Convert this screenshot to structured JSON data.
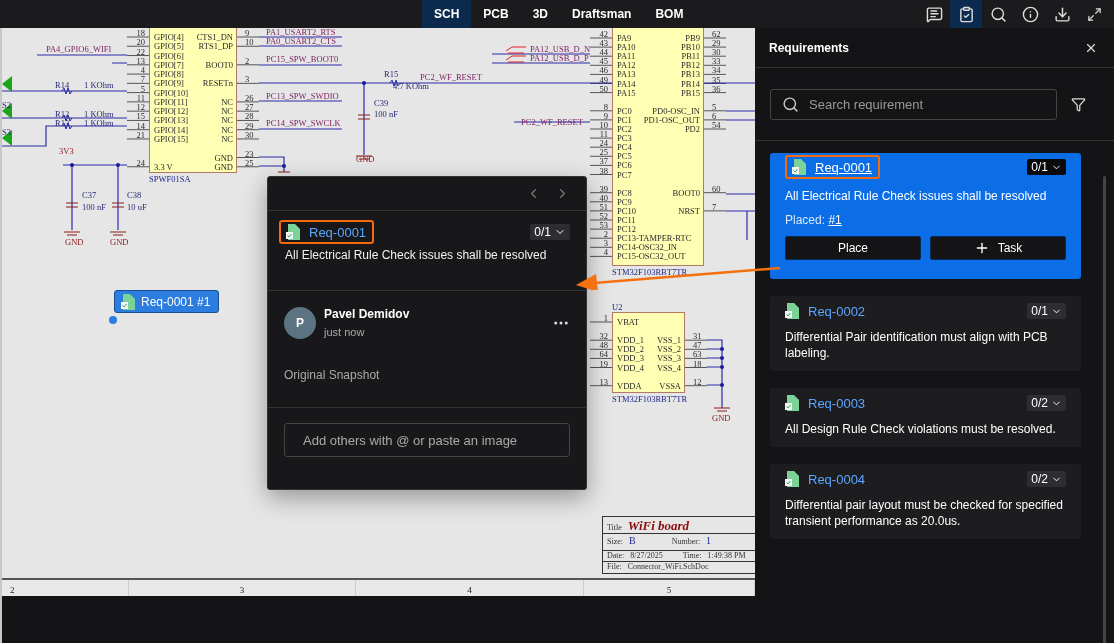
{
  "toolbar": {
    "tabs": [
      {
        "label": "SCH",
        "selected": true
      },
      {
        "label": "PCB",
        "selected": false
      },
      {
        "label": "3D",
        "selected": false
      },
      {
        "label": "Draftsman",
        "selected": false
      },
      {
        "label": "BOM",
        "selected": false
      }
    ],
    "requirements_button": {
      "selected": true
    }
  },
  "schematic": {
    "chips": [
      {
        "part": "SPWF01SA",
        "left_pins": [
          {
            "number": "18",
            "name": "GPIO[4]"
          },
          {
            "number": "20",
            "name": "GPIO[5]"
          },
          {
            "number": "22",
            "name": "GPIO[6]"
          },
          {
            "number": "13",
            "name": "GPIO[7]"
          },
          {
            "number": "4",
            "name": "GPIO[8]"
          },
          {
            "number": "7",
            "name": "GPIO[9]"
          },
          {
            "number": "5",
            "name": "GPIO[10]"
          },
          {
            "number": "11",
            "name": "GPIO[11]"
          },
          {
            "number": "12",
            "name": "GPIO[12]"
          },
          {
            "number": "15",
            "name": "GPIO[13]"
          },
          {
            "number": "14",
            "name": "GPIO[14]"
          },
          {
            "number": "21",
            "name": "GPIO[15]"
          },
          {
            "number": "24",
            "name": "3.3 V"
          }
        ],
        "right_pins": [
          {
            "number": "9",
            "name": "CTS1_DN"
          },
          {
            "number": "10",
            "name": "RTS1_DP"
          },
          {
            "number": "2",
            "name": "BOOT0"
          },
          {
            "number": "3",
            "name": "RESETn"
          },
          {
            "number": "26",
            "name": "NC"
          },
          {
            "number": "27",
            "name": "NC"
          },
          {
            "number": "28",
            "name": "NC"
          },
          {
            "number": "29",
            "name": "NC"
          },
          {
            "number": "30",
            "name": "NC"
          },
          {
            "number": "23",
            "name": "GND"
          },
          {
            "number": "25",
            "name": "GND"
          }
        ]
      },
      {
        "part": "STM32F103RBT7TR",
        "left_pins": [
          {
            "number": "42",
            "name": "PA9"
          },
          {
            "number": "43",
            "name": "PA10"
          },
          {
            "number": "44",
            "name": "PA11"
          },
          {
            "number": "45",
            "name": "PA12"
          },
          {
            "number": "46",
            "name": "PA13"
          },
          {
            "number": "49",
            "name": "PA14"
          },
          {
            "number": "50",
            "name": "PA15"
          },
          {
            "number": "8",
            "name": "PC0"
          },
          {
            "number": "9",
            "name": "PC1"
          },
          {
            "number": "10",
            "name": "PC2"
          },
          {
            "number": "11",
            "name": "PC3"
          },
          {
            "number": "24",
            "name": "PC4"
          },
          {
            "number": "25",
            "name": "PC5"
          },
          {
            "number": "37",
            "name": "PC6"
          },
          {
            "number": "38",
            "name": "PC7"
          },
          {
            "number": "39",
            "name": "PC8"
          },
          {
            "number": "40",
            "name": "PC9"
          },
          {
            "number": "51",
            "name": "PC10"
          },
          {
            "number": "52",
            "name": "PC11"
          },
          {
            "number": "53",
            "name": "PC12"
          },
          {
            "number": "2",
            "name": "PC13-TAMPER-RTC"
          },
          {
            "number": "3",
            "name": "PC14-OSC32_IN"
          },
          {
            "number": "4",
            "name": "PC15-OSC32_OUT"
          }
        ],
        "right_pins": [
          {
            "number": "62",
            "name": "PB9"
          },
          {
            "number": "29",
            "name": "PB10"
          },
          {
            "number": "30",
            "name": "PB11"
          },
          {
            "number": "33",
            "name": "PB12"
          },
          {
            "number": "34",
            "name": "PB13"
          },
          {
            "number": "35",
            "name": "PB14"
          },
          {
            "number": "36",
            "name": "PB15"
          },
          {
            "number": "5",
            "name": "PD0-OSC_IN"
          },
          {
            "number": "6",
            "name": "PD1-OSC_OUT"
          },
          {
            "number": "54",
            "name": "PD2"
          },
          {
            "number": "60",
            "name": "BOOT0"
          },
          {
            "number": "7",
            "name": "NRST"
          }
        ]
      },
      {
        "designator": "U2",
        "part": "STM32F103RBT7TR",
        "left_pins": [
          {
            "number": "1",
            "name": "VBAT"
          },
          {
            "number": "32",
            "name": "VDD_1"
          },
          {
            "number": "48",
            "name": "VDD_2"
          },
          {
            "number": "64",
            "name": "VDD_3"
          },
          {
            "number": "19",
            "name": "VDD_4"
          },
          {
            "number": "13",
            "name": "VDDA"
          }
        ],
        "right_pins": [
          {
            "number": "31",
            "name": "VSS_1"
          },
          {
            "number": "47",
            "name": "VSS_2"
          },
          {
            "number": "63",
            "name": "VSS_3"
          },
          {
            "number": "18",
            "name": "VSS_4"
          },
          {
            "number": "12",
            "name": "VSSA"
          }
        ]
      }
    ],
    "net_labels": [
      "PA4_GPIO6_WIFI",
      "PA1_USART2_RTS",
      "PA0_USART2_CTS",
      "PC15_SPW_BOOT0",
      "PC13_SPW_SWDIO",
      "PC14_SPW_SWCLK",
      "PC2_WF_RESET",
      "PA12_USB_D_N",
      "PA12_USB_D_P",
      "PC2_WF_RESET"
    ],
    "parts": [
      {
        "ref": "R14",
        "value": "1 KOhm"
      },
      {
        "ref": "R12",
        "value": "1 KOhm"
      },
      {
        "ref": "R13",
        "value": "1 KOhm"
      },
      {
        "ref": "R15",
        "value": "4.7 KOhm"
      },
      {
        "ref": "C37",
        "value": "100 nF"
      },
      {
        "ref": "C38",
        "value": "10 uF"
      },
      {
        "ref": "C39",
        "value": "100 nF"
      }
    ],
    "power_labels": [
      "3V3",
      "GND",
      "GND",
      "GND",
      "GND"
    ],
    "connector_labels": [
      "S2",
      "S3"
    ],
    "title_block": {
      "title_caption": "Title",
      "title": "WiFi board",
      "size_caption": "Size:",
      "size": "B",
      "number_caption": "Number:",
      "number": "1",
      "date_caption": "Date:",
      "date": "8/27/2025",
      "time_caption": "Time:",
      "time": "1:49:38 PM",
      "file_caption": "File:",
      "file": "Connector_WiFi.SchDoc"
    },
    "ruler": [
      "2",
      "3",
      "4",
      "5"
    ]
  },
  "placement_pin": {
    "label": "Req-0001 #1"
  },
  "comment_popup": {
    "requirement_id": "Req-0001",
    "count": "0/1",
    "text": "All Electrical Rule Check issues shall be resolved",
    "author": "Pavel Demidov",
    "initial": "P",
    "time": "just now",
    "snapshot": "Original Snapshot",
    "placeholder": "Add others with @ or paste an image"
  },
  "requirements_panel": {
    "title": "Requirements",
    "search_placeholder": "Search requirement",
    "items": [
      {
        "id": "Req-0001",
        "count": "0/1",
        "text": "All Electrical Rule Check issues shall be resolved",
        "selected": true,
        "placed_caption": "Placed:",
        "placed": "#1",
        "actions": [
          "Place",
          "Task"
        ]
      },
      {
        "id": "Req-0002",
        "count": "0/1",
        "text": "Differential Pair identification must align with PCB labeling.",
        "selected": false
      },
      {
        "id": "Req-0003",
        "count": "0/2",
        "text": "All Design Rule Check violations must be resolved.",
        "selected": false
      },
      {
        "id": "Req-0004",
        "count": "0/2",
        "text": "Differential pair layout must be checked for specified transient performance as 20.0us.",
        "selected": false
      }
    ]
  }
}
